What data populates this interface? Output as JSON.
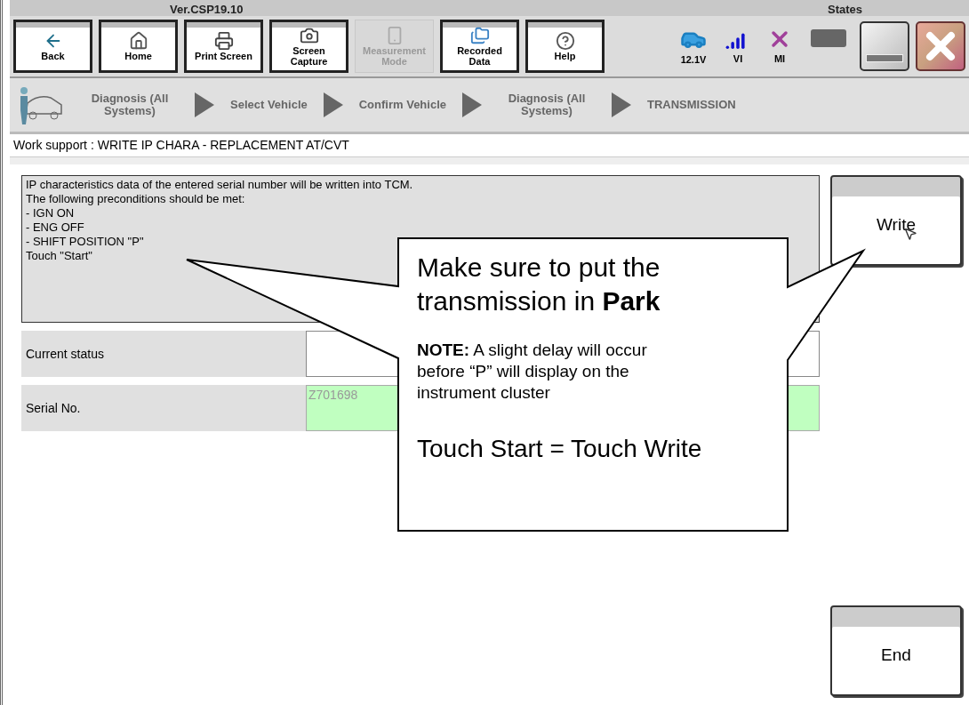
{
  "title_bar": {
    "version": "Ver.CSP19.10",
    "states_label": "States"
  },
  "toolbar": [
    {
      "label": "Back",
      "kind": "back",
      "disabled": false
    },
    {
      "label": "Home",
      "kind": "home",
      "disabled": false
    },
    {
      "label": "Print Screen",
      "kind": "print",
      "disabled": false
    },
    {
      "label": "Screen Capture",
      "kind": "camera",
      "disabled": false
    },
    {
      "label": "Measurement Mode",
      "kind": "measure",
      "disabled": true
    },
    {
      "label": "Recorded Data",
      "kind": "folders",
      "disabled": false
    },
    {
      "label": "Help",
      "kind": "help",
      "disabled": false
    }
  ],
  "status": {
    "voltage": "12.1V",
    "vi": "VI",
    "mi": "MI"
  },
  "breadcrumb": [
    {
      "label": "Diagnosis (All Systems)"
    },
    {
      "label": "Select Vehicle"
    },
    {
      "label": "Confirm Vehicle"
    },
    {
      "label": "Diagnosis (All Systems)"
    },
    {
      "label": "TRANSMISSION"
    }
  ],
  "work_support_title": "Work support : WRITE IP CHARA - REPLACEMENT AT/CVT",
  "message": [
    "IP characteristics data of the entered serial number will be written into TCM.",
    "The following preconditions should be met:",
    "- IGN ON",
    "- ENG OFF",
    "- SHIFT POSITION \"P\"",
    "Touch \"Start\""
  ],
  "fields": [
    {
      "label": "Current status",
      "kind": "status"
    },
    {
      "label": "Serial No.",
      "kind": "serial",
      "value": "Z701698"
    }
  ],
  "buttons": [
    "Write",
    "End"
  ],
  "callout": {
    "heading": "Make sure to put the transmission in **Park**",
    "note": "**NOTE:** A slight delay will occur before “P” will display on the instrument cluster",
    "footer": "Touch Start = Touch Write"
  }
}
